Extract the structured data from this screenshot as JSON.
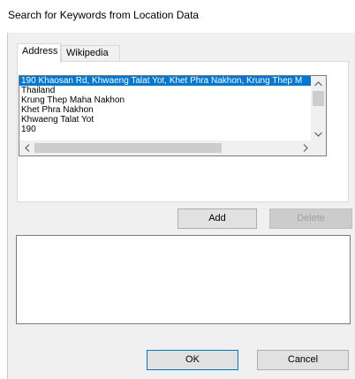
{
  "window": {
    "title": "Search for Keywords from Location Data"
  },
  "tabs": [
    {
      "label": "Address",
      "active": true
    },
    {
      "label": "Wikipedia",
      "active": false
    }
  ],
  "address_list": {
    "items": [
      "190 Khaosan Rd, Khwaeng Talat Yot, Khet Phra Nakhon, Krung Thep M",
      "Thailand",
      "Krung Thep Maha Nakhon",
      "Khet Phra Nakhon",
      "Khwaeng Talat Yot",
      "190"
    ],
    "selected_index": 0
  },
  "buttons": {
    "add": "Add",
    "delete": "Delete",
    "ok": "OK",
    "cancel": "Cancel"
  },
  "keywords_text": "",
  "colors": {
    "selection": "#0078d7",
    "face": "#f0f0f0",
    "focus_border": "#0078d7"
  }
}
